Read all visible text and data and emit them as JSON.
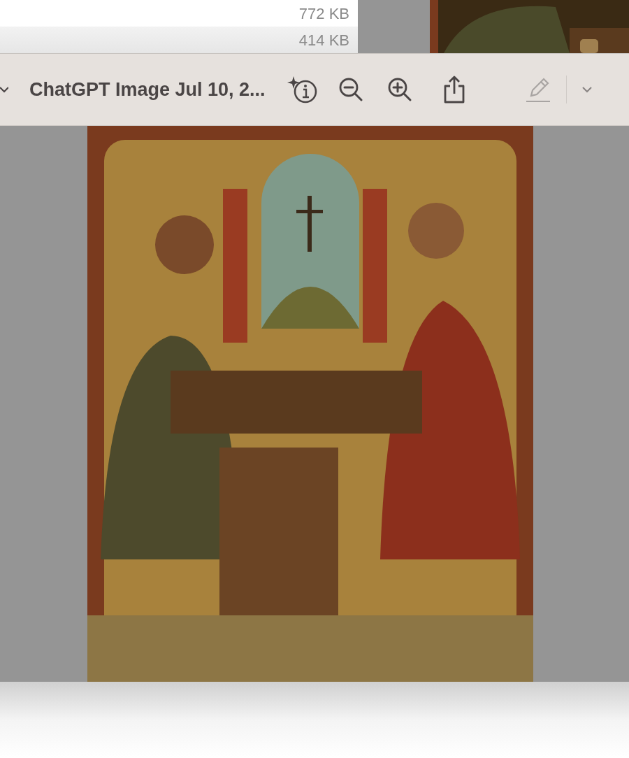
{
  "file_list": {
    "rows": [
      {
        "size": "772 KB",
        "selected": false
      },
      {
        "size": "414 KB",
        "selected": true
      }
    ]
  },
  "toolbar": {
    "title": "ChatGPT Image Jul 10, 2...",
    "markup_disabled": true
  }
}
